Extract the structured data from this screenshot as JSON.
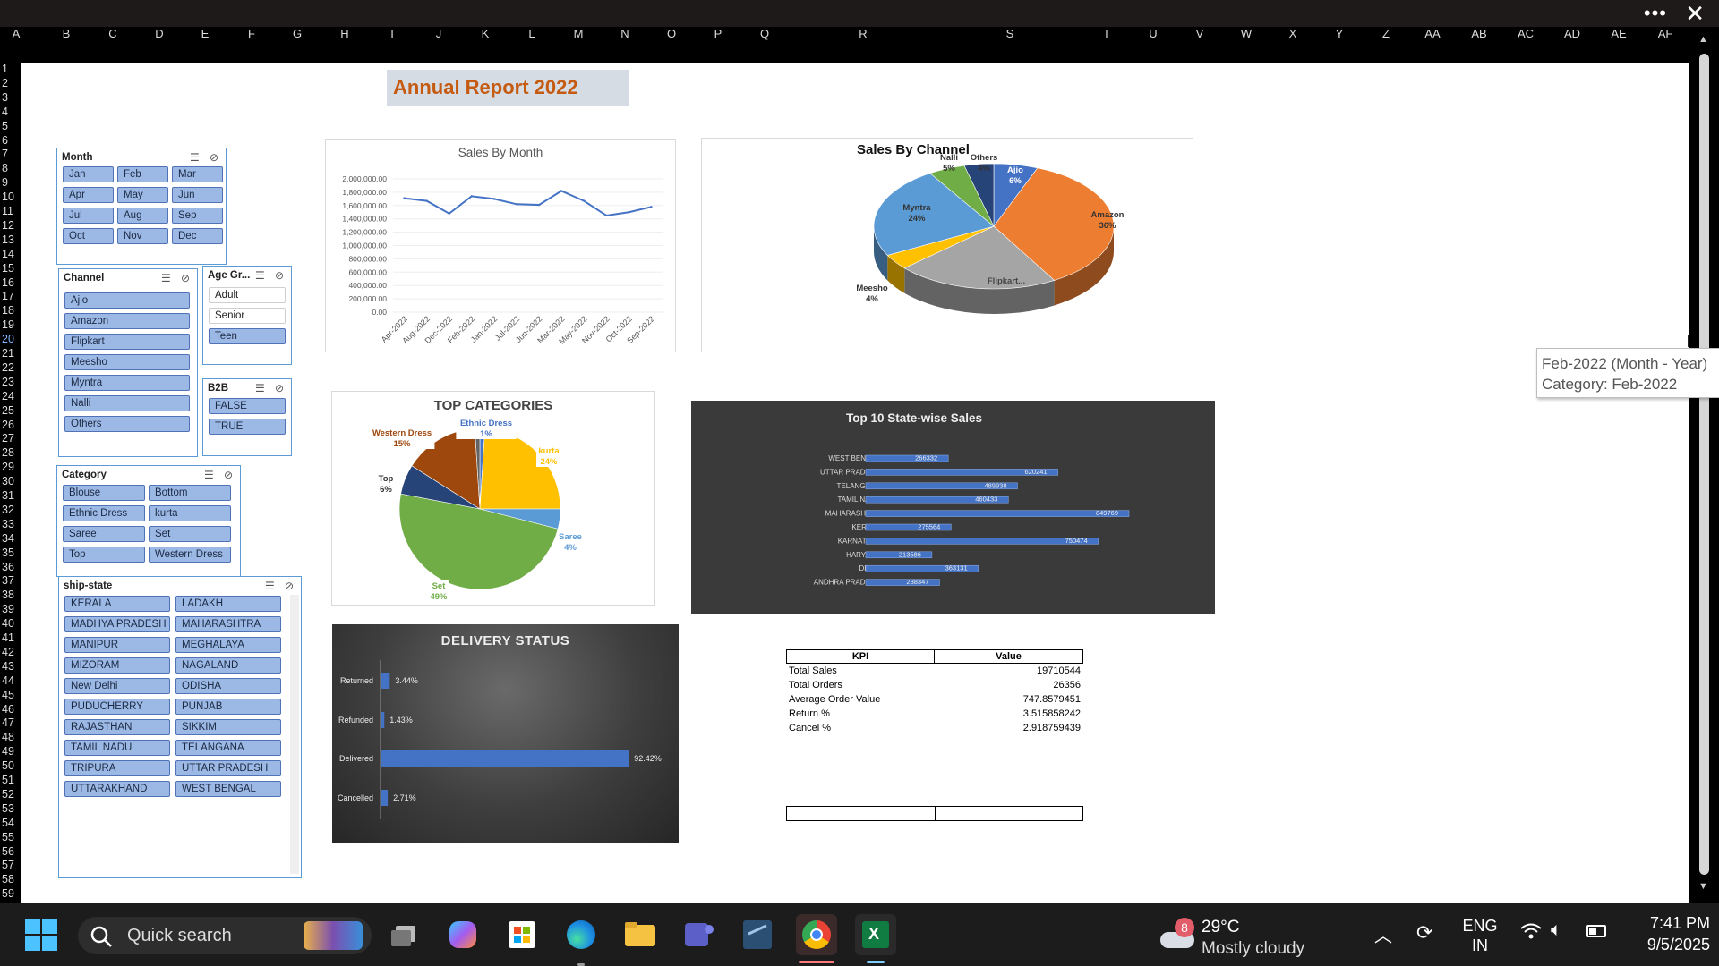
{
  "window": {
    "menu_icon": "more-horizontal-icon",
    "close_icon": "close-icon"
  },
  "columns": [
    "A",
    "B",
    "C",
    "D",
    "E",
    "F",
    "G",
    "H",
    "I",
    "J",
    "K",
    "L",
    "M",
    "N",
    "O",
    "P",
    "Q",
    "R",
    "S",
    "T",
    "U",
    "V",
    "W",
    "X",
    "Y",
    "Z",
    "AA",
    "AB",
    "AC",
    "AD",
    "AE",
    "AF"
  ],
  "rows": [
    "1",
    "2",
    "3",
    "4",
    "5",
    "6",
    "7",
    "8",
    "9",
    "10",
    "11",
    "12",
    "13",
    "14",
    "15",
    "16",
    "17",
    "18",
    "19",
    "20",
    "21",
    "22",
    "23",
    "24",
    "25",
    "26",
    "27",
    "28",
    "29",
    "30",
    "31",
    "32",
    "33",
    "34",
    "35",
    "36",
    "37",
    "38",
    "39",
    "40",
    "41",
    "42",
    "43",
    "44",
    "45",
    "46",
    "47",
    "48",
    "49",
    "50",
    "51",
    "52",
    "53",
    "54",
    "55",
    "56",
    "57",
    "58",
    "59"
  ],
  "report": {
    "title": "Annual Report 2022"
  },
  "tooltip": {
    "line1": "Feb-2022 (Month - Year)",
    "line2": "Category: Feb-2022"
  },
  "slicers": {
    "month": {
      "title": "Month",
      "items": [
        "Jan",
        "Feb",
        "Mar",
        "Apr",
        "May",
        "Jun",
        "Jul",
        "Aug",
        "Sep",
        "Oct",
        "Nov",
        "Dec"
      ]
    },
    "channel": {
      "title": "Channel",
      "items": [
        "Ajio",
        "Amazon",
        "Flipkart",
        "Meesho",
        "Myntra",
        "Nalli",
        "Others"
      ]
    },
    "age": {
      "title": "Age Gr...",
      "items": [
        "Adult",
        "Senior",
        "Teen"
      ],
      "selected": [
        "Teen"
      ]
    },
    "b2b": {
      "title": "B2B",
      "items": [
        "FALSE",
        "TRUE"
      ]
    },
    "category": {
      "title": "Category",
      "items": [
        "Blouse",
        "Bottom",
        "Ethnic Dress",
        "kurta",
        "Saree",
        "Set",
        "Top",
        "Western Dress"
      ]
    },
    "shipstate": {
      "title": "ship-state",
      "items": [
        "KERALA",
        "LADAKH",
        "MADHYA PRADESH",
        "MAHARASHTRA",
        "MANIPUR",
        "MEGHALAYA",
        "MIZORAM",
        "NAGALAND",
        "New Delhi",
        "ODISHA",
        "PUDUCHERRY",
        "PUNJAB",
        "RAJASTHAN",
        "SIKKIM",
        "TAMIL NADU",
        "TELANGANA",
        "TRIPURA",
        "UTTAR PRADESH",
        "UTTARAKHAND",
        "WEST BENGAL"
      ]
    }
  },
  "kpi": {
    "headers": [
      "KPI",
      "Value"
    ],
    "rows": [
      [
        "Total Sales",
        "19710544"
      ],
      [
        "Total Orders",
        "26356"
      ],
      [
        "Average Order Value",
        "747.8579451"
      ],
      [
        "Return %",
        "3.515858242"
      ],
      [
        "Cancel %",
        "2.918759439"
      ]
    ]
  },
  "chart_data": [
    {
      "type": "line",
      "title": "Sales By Month",
      "x": [
        "Apr-2022",
        "Aug-2022",
        "Dec-2022",
        "Feb-2022",
        "Jan-2022",
        "Jul-2022",
        "Jun-2022",
        "Mar-2022",
        "May-2022",
        "Nov-2022",
        "Oct-2022",
        "Sep-2022"
      ],
      "series": [
        {
          "values": [
            1710000,
            1670000,
            1480000,
            1740000,
            1700000,
            1620000,
            1610000,
            1820000,
            1670000,
            1450000,
            1500000,
            1580000
          ]
        }
      ],
      "yticks": [
        "2,000,000.00",
        "1,800,000.00",
        "1,600,000.00",
        "1,400,000.00",
        "1,200,000.00",
        "1,000,000.00",
        "800,000.00",
        "600,000.00",
        "400,000.00",
        "200,000.00",
        "0.00"
      ],
      "ylim": [
        0,
        2000000
      ],
      "color": "#4472c4"
    },
    {
      "type": "pie",
      "title": "Sales By Channel",
      "slices": [
        {
          "label": "Ajio",
          "pct": "6%",
          "value": 6,
          "color": "#4472c4"
        },
        {
          "label": "Amazon",
          "pct": "36%",
          "value": 36,
          "color": "#ed7d31"
        },
        {
          "label": "Flipkart...",
          "pct": "",
          "value": 22,
          "color": "#a5a5a5"
        },
        {
          "label": "Meesho",
          "pct": "4%",
          "value": 4,
          "color": "#ffc000"
        },
        {
          "label": "Myntra",
          "pct": "24%",
          "value": 24,
          "color": "#5b9bd5"
        },
        {
          "label": "Nalli",
          "pct": "5%",
          "value": 5,
          "color": "#70ad47"
        },
        {
          "label": "Others",
          "pct": "4%",
          "value": 4,
          "color": "#264478"
        }
      ]
    },
    {
      "type": "pie",
      "title": "TOP CATEGORIES",
      "slices": [
        {
          "label": "Ethnic Dress",
          "pct": "1%",
          "value": 1,
          "color": "#4472c4"
        },
        {
          "label": "kurta",
          "pct": "24%",
          "value": 24,
          "color": "#ffc000"
        },
        {
          "label": "Saree",
          "pct": "4%",
          "value": 4,
          "color": "#5b9bd5"
        },
        {
          "label": "Set",
          "pct": "49%",
          "value": 49,
          "color": "#70ad47"
        },
        {
          "label": "Top",
          "pct": "6%",
          "value": 6,
          "color": "#264478"
        },
        {
          "label": "Western Dress",
          "pct": "15%",
          "value": 15,
          "color": "#9e480e"
        },
        {
          "label": "",
          "pct": "",
          "value": 1,
          "color": "#636363"
        }
      ]
    },
    {
      "type": "bar",
      "title": "Top 10 State-wise Sales",
      "categories": [
        "WEST BENGAL",
        "UTTAR PRADESH",
        "TELANGANA",
        "TAMIL NADU",
        "MAHARASHTRA",
        "KERALA",
        "KARNATAKA",
        "HARYANA",
        "DELHI",
        "ANDHRA PRADESH"
      ],
      "values": [
        266332,
        620241,
        489938,
        460433,
        849769,
        275564,
        750474,
        213586,
        363131,
        238347
      ],
      "color": "#4472c4"
    },
    {
      "type": "bar",
      "title": "DELIVERY STATUS",
      "categories": [
        "Returned",
        "Refunded",
        "Delivered",
        "Cancelled"
      ],
      "values": [
        3.44,
        1.43,
        92.42,
        2.71
      ],
      "labels": [
        "3.44%",
        "1.43%",
        "92.42%",
        "2.71%"
      ],
      "color": "#4472c4"
    }
  ],
  "taskbar": {
    "search": "Quick search",
    "weather_temp": "29°C",
    "weather_desc": "Mostly cloudy",
    "weather_badge": "8",
    "lang1": "ENG",
    "lang2": "IN",
    "time": "7:41 PM",
    "date": "9/5/2025"
  }
}
